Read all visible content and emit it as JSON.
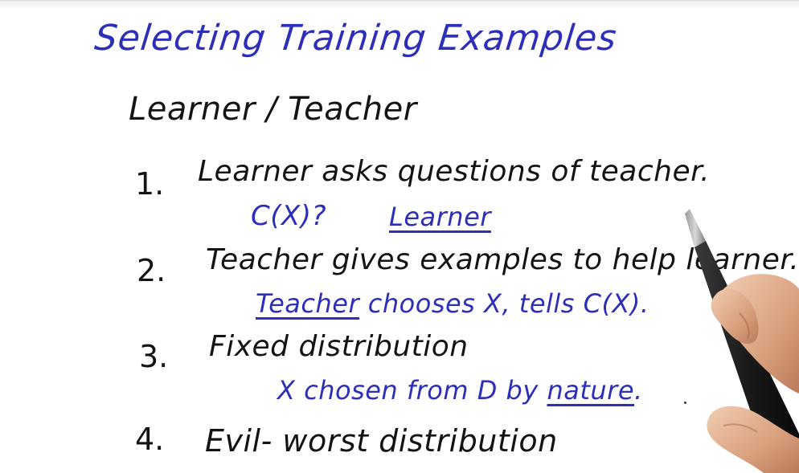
{
  "title": "Selecting Training Examples",
  "subtitle": "Learner / Teacher",
  "items": [
    {
      "number": "1.",
      "text": "Learner asks questions of teacher."
    },
    {
      "number": "2.",
      "text": "Teacher gives examples to help learner."
    },
    {
      "number": "3.",
      "text": "Fixed distribution"
    },
    {
      "number": "4.",
      "text": "Evil- worst distribution"
    }
  ],
  "notes": {
    "item1_query": "C(X)?",
    "item1_who": "Learner",
    "item2_who": "Teacher",
    "item2_rest": " chooses X, tells C(X).",
    "item3_pre": "X chosen from D by ",
    "item3_who": "nature",
    "item3_post": "."
  },
  "colors": {
    "blue_ink": "#2d2fb8",
    "black_ink": "#141414",
    "background": "#ffffff"
  }
}
